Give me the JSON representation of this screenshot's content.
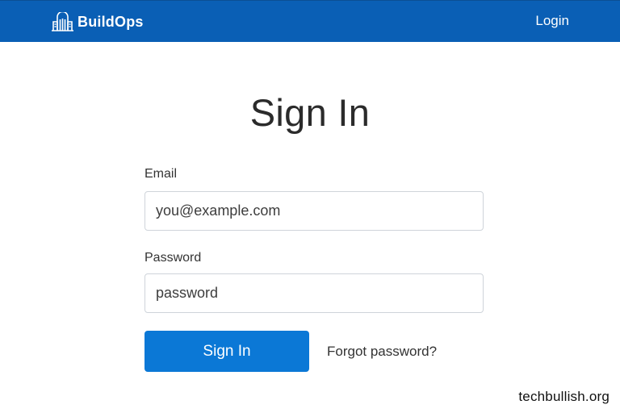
{
  "navbar": {
    "brand_name": "BuildOps",
    "login_label": "Login",
    "background_color": "#0a5fb5",
    "logo_icon": "building-icon"
  },
  "form": {
    "title": "Sign In",
    "email_label": "Email",
    "email_placeholder": "you@example.com",
    "password_label": "Password",
    "password_placeholder": "password",
    "submit_label": "Sign In",
    "submit_color": "#0b78d6",
    "forgot_label": "Forgot password?"
  },
  "watermark": {
    "text": "techbullish.org"
  }
}
